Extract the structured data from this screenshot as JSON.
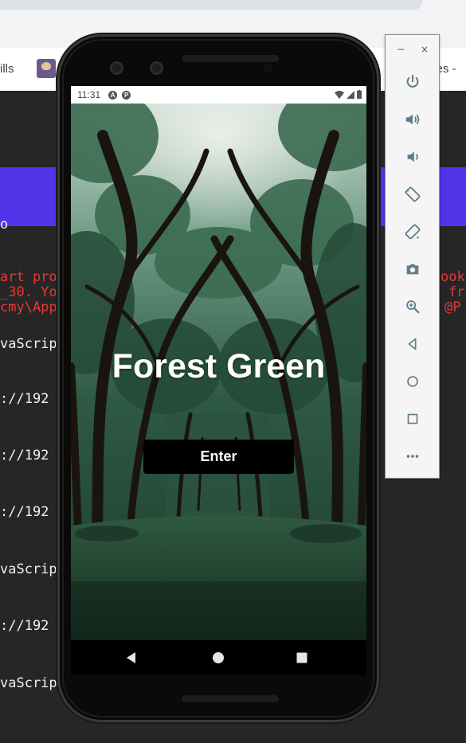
{
  "desktop": {
    "bookmarks": {
      "left_text": "ills",
      "right_text": "ses -"
    },
    "terminal_lines": [
      {
        "text": "o",
        "color": "#f2f2f2"
      },
      {
        "text": "art pro",
        "color": "#e53935"
      },
      {
        "text": "_30. Yo",
        "color": "#e53935"
      },
      {
        "text": "cmy\\App",
        "color": "#e53935"
      },
      {
        "text": "vaScrip",
        "color": "#f2f2f2"
      },
      {
        "text": "://192",
        "color": "#f2f2f2"
      },
      {
        "text": "://192",
        "color": "#f2f2f2"
      },
      {
        "text": "://192",
        "color": "#f2f2f2"
      },
      {
        "text": "vaScrip",
        "color": "#f2f2f2"
      },
      {
        "text": "://192",
        "color": "#f2f2f2"
      },
      {
        "text": "vaScrip",
        "color": "#f2f2f2"
      }
    ],
    "terminal_right": [
      "ook",
      "fr",
      "@P"
    ]
  },
  "emulator_panel": {
    "minimize_label": "−",
    "close_label": "×",
    "buttons": [
      {
        "name": "power-icon"
      },
      {
        "name": "volume-up-icon"
      },
      {
        "name": "volume-down-icon"
      },
      {
        "name": "rotate-left-icon"
      },
      {
        "name": "rotate-right-icon"
      },
      {
        "name": "camera-icon"
      },
      {
        "name": "zoom-icon"
      },
      {
        "name": "back-icon"
      },
      {
        "name": "home-icon"
      },
      {
        "name": "overview-icon"
      },
      {
        "name": "more-icon"
      }
    ]
  },
  "phone": {
    "status_bar": {
      "time": "11:31",
      "icons": [
        "A",
        "P"
      ]
    },
    "app": {
      "title": "Forest Green",
      "enter_label": "Enter"
    },
    "colors": {
      "accent_banner": "#4f34e8",
      "button_bg": "#000000",
      "forest_dark": "#1f3d2e"
    }
  }
}
